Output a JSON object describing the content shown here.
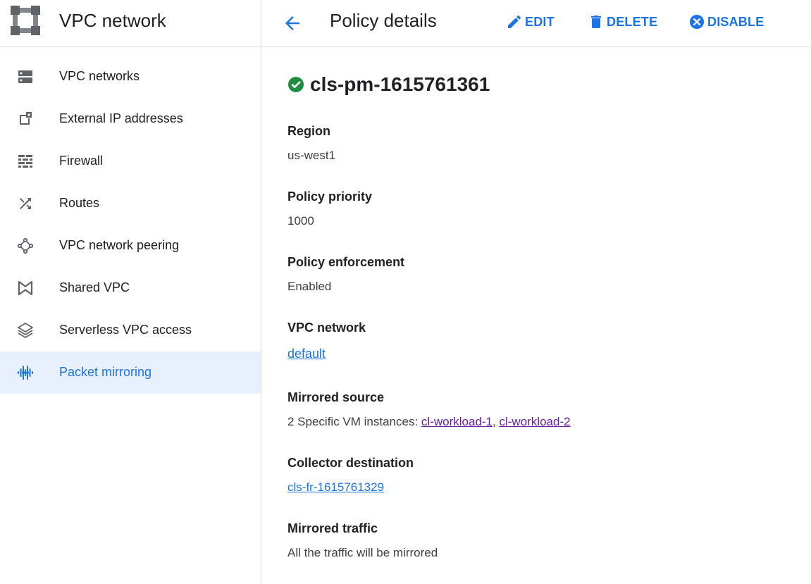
{
  "sidebar": {
    "title": "VPC network",
    "items": [
      {
        "label": "VPC networks"
      },
      {
        "label": "External IP addresses"
      },
      {
        "label": "Firewall"
      },
      {
        "label": "Routes"
      },
      {
        "label": "VPC network peering"
      },
      {
        "label": "Shared VPC"
      },
      {
        "label": "Serverless VPC access"
      },
      {
        "label": "Packet mirroring",
        "active": true
      }
    ]
  },
  "header": {
    "title": "Policy details",
    "edit_label": "EDIT",
    "delete_label": "DELETE",
    "disable_label": "DISABLE"
  },
  "policy": {
    "name": "cls-pm-1615761361",
    "status": "active",
    "fields": {
      "region": {
        "label": "Region",
        "value": "us-west1"
      },
      "priority": {
        "label": "Policy priority",
        "value": "1000"
      },
      "enforcement": {
        "label": "Policy enforcement",
        "value": "Enabled"
      },
      "network": {
        "label": "VPC network",
        "value": "default"
      },
      "source": {
        "label": "Mirrored source",
        "prefix": "2 Specific VM instances: ",
        "instances": [
          "cl-workload-1",
          "cl-workload-2"
        ],
        "separator": ", "
      },
      "collector": {
        "label": "Collector destination",
        "value": "cls-fr-1615761329"
      },
      "traffic": {
        "label": "Mirrored traffic",
        "value": "All the traffic will be mirrored"
      }
    }
  },
  "colors": {
    "accent": "#1a73e8",
    "visited_link": "#681da8",
    "status_ok": "#1e8e3e",
    "active_bg": "#e8f0fe",
    "icon_gray": "#5f6368"
  }
}
